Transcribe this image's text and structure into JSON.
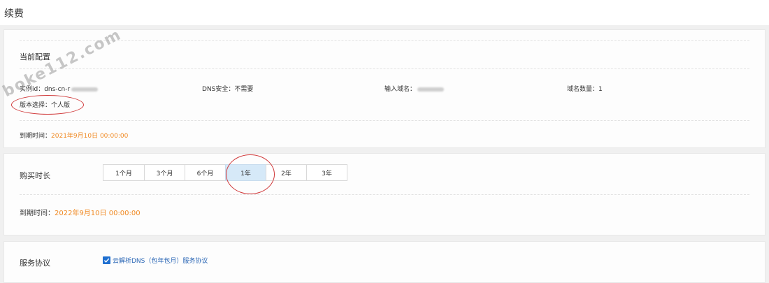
{
  "page": {
    "title": "续费"
  },
  "config": {
    "title": "当前配置",
    "instance_label": "实例id：",
    "instance_value": "dns-cn-r",
    "dns_security_label": "DNS安全：",
    "dns_security_value": "不需要",
    "domain_input_label": "输入域名：",
    "domain_count_label": "域名数量：",
    "domain_count_value": "1",
    "version_label": "版本选择：",
    "version_value": "个人版",
    "expire_label": "到期时间：",
    "expire_value": "2021年9月10日 00:00:00"
  },
  "duration": {
    "title": "购买时长",
    "options": [
      "1个月",
      "3个月",
      "6个月",
      "1年",
      "2年",
      "3年"
    ],
    "selected": "1年",
    "expire_label": "到期时间：",
    "expire_value": "2022年9月10日 00:00:00"
  },
  "agreement": {
    "title": "服务协议",
    "checked": true,
    "link_text": "云解析DNS（包年包月）服务协议"
  },
  "watermark": {
    "text": "boke112.com"
  },
  "colors": {
    "accent": "#f08a24",
    "link": "#2a66b5",
    "selected_bg": "#d6e9f8",
    "annotation": "#d0393a"
  }
}
